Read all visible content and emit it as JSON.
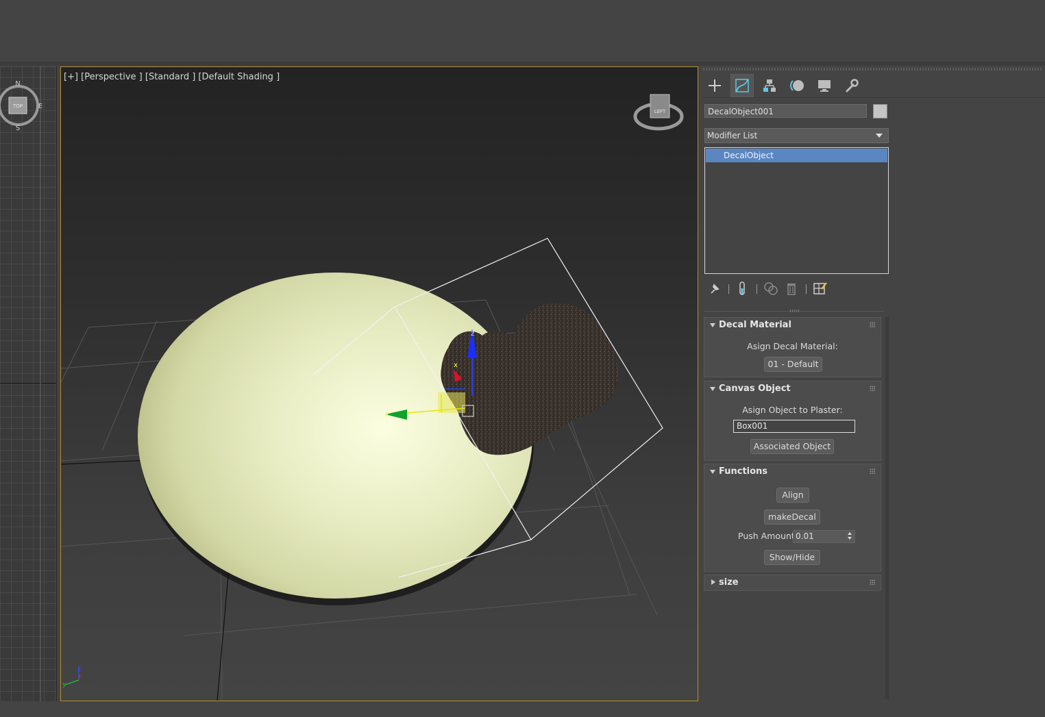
{
  "viewport": {
    "label": "[+] [Perspective ] [Standard ] [Default Shading ]",
    "gizmo_axes": {
      "x": "x",
      "y": "y",
      "z": "z"
    },
    "viewcube_face": "LEFT"
  },
  "left_viewport": {
    "compass": {
      "n": "N",
      "e": "E",
      "s": "S",
      "cube_face": "TOP"
    }
  },
  "command_panel": {
    "tabs": [
      {
        "name": "create-tab",
        "icon": "plus-icon"
      },
      {
        "name": "modify-tab",
        "icon": "modify-curve-icon",
        "active": true
      },
      {
        "name": "hierarchy-tab",
        "icon": "hierarchy-icon"
      },
      {
        "name": "motion-tab",
        "icon": "motion-icon"
      },
      {
        "name": "display-tab",
        "icon": "monitor-icon"
      },
      {
        "name": "utilities-tab",
        "icon": "wrench-icon"
      }
    ],
    "object_name": "DecalObject001",
    "object_color": "#c5c5c5",
    "modifier_list_label": "Modifier List",
    "stack": [
      "DecalObject"
    ],
    "rollouts": {
      "decal_material": {
        "title": "Decal Material",
        "assign_label": "Asign Decal Material:",
        "material_button": "01 - Default"
      },
      "canvas_object": {
        "title": "Canvas Object",
        "assign_label": "Asign Object to Plaster:",
        "object_value": "Box001",
        "associated_button": "Associated Object"
      },
      "functions": {
        "title": "Functions",
        "align_button": "Align",
        "make_decal_button": "makeDecal",
        "push_amount_label": "Push Amount",
        "push_amount_value": "0.01",
        "show_hide_button": "Show/Hide"
      },
      "size": {
        "title": "size"
      }
    }
  },
  "colors": {
    "accent_selection": "#5a86c2",
    "viewport_border": "#b58e2d",
    "sphere": "#e9edc4"
  }
}
